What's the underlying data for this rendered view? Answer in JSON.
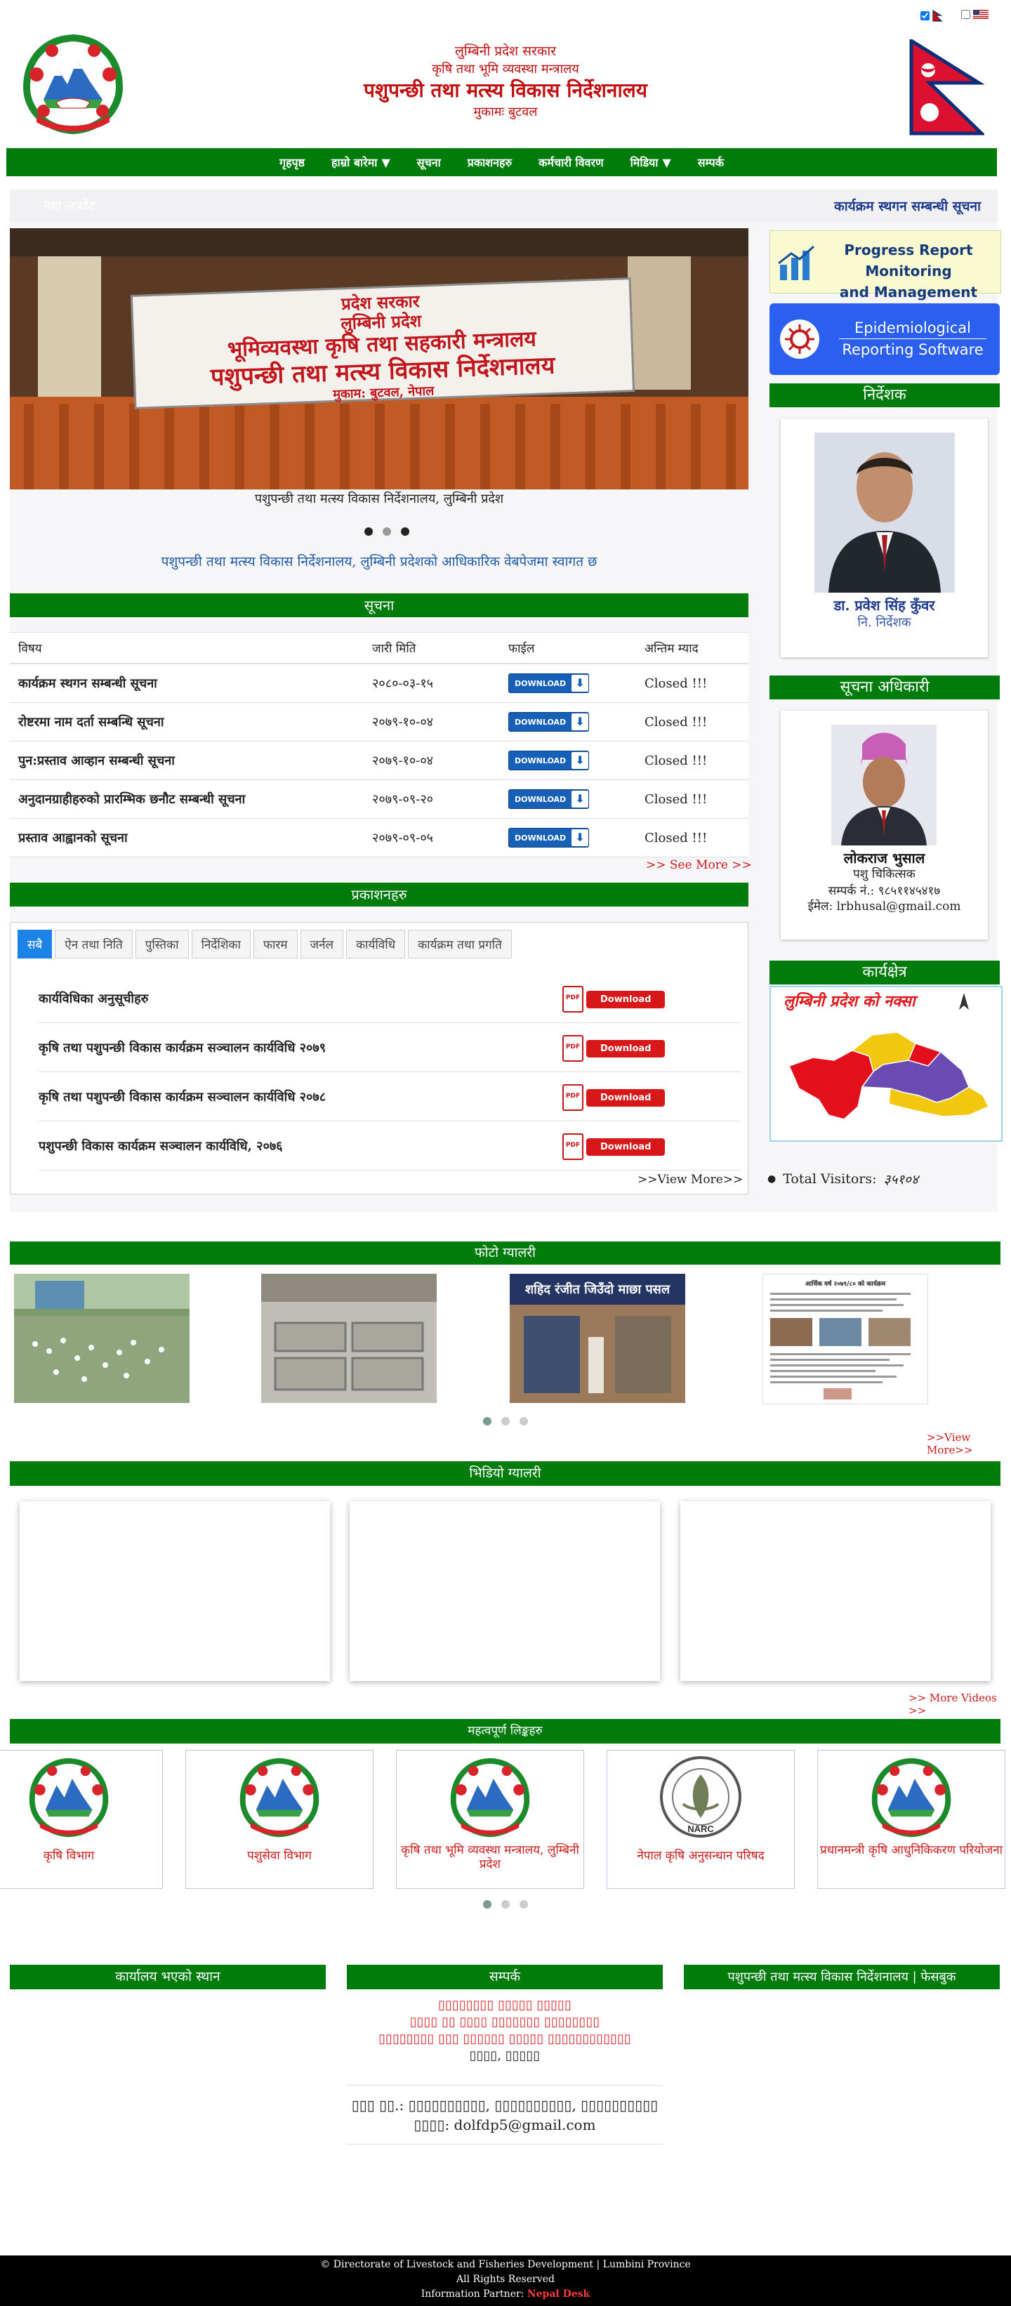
{
  "colors": {
    "green": "#007c0d",
    "red": "#c10d0d",
    "blue_link": "#1d3a8f",
    "download_blue": "#1660b7"
  },
  "header": {
    "line1": "लुम्बिनी प्रदेश सरकार",
    "line2": "कृषि तथा भूमि व्यवस्था मन्त्रालय",
    "line3": "पशुपन्छी तथा मत्स्य विकास निर्देशनालय",
    "line4": "मुकामः बुटवल",
    "emblem_icon": "nepal-emblem-icon",
    "flag_icon": "nepal-flag-icon"
  },
  "language": {
    "nepali_flag": "nepal-flag-icon",
    "english_flag": "us-flag-icon",
    "nepali_checked": true
  },
  "nav": {
    "items": [
      {
        "label": "गृहपृष्ठ"
      },
      {
        "label": "हाम्रो बारेमा",
        "dropdown": true
      },
      {
        "label": "सूचना"
      },
      {
        "label": "प्रकाशनहरु"
      },
      {
        "label": "कर्मचारी विवरण"
      },
      {
        "label": "मिडिया",
        "dropdown": true
      },
      {
        "label": "सम्पर्क"
      }
    ]
  },
  "ticker": {
    "left": "नया अपडेट",
    "right": "कार्यक्रम स्थगन सम्बन्धी सूचना"
  },
  "slider": {
    "sign_lines": [
      "प्रदेश सरकार",
      "लुम्बिनी प्रदेश",
      "भूमिव्यवस्था कृषि तथा सहकारी मन्त्रालय",
      "पशुपन्छी तथा मत्स्य विकास निर्देशनालय",
      "मुकाम: बुटवल, नेपाल"
    ],
    "caption": "पशुपन्छी तथा मत्स्य विकास निर्देशनालय, लुम्बिनी प्रदेश",
    "active_index": 2
  },
  "welcome": "पशुपन्छी तथा मत्स्य विकास निर्देशनालय, लुम्बिनी प्रदेशको आधिकारिक वेबपेजमा स्वागत छ",
  "notices": {
    "title": "सूचना",
    "headers": [
      "विषय",
      "जारी मिति",
      "फाईल",
      "अन्तिम म्याद"
    ],
    "download_label": "DOWNLOAD",
    "rows": [
      {
        "subject": "कार्यक्रम स्थगन सम्बन्धी सूचना",
        "date": "२०८०-०३-१५",
        "status": "Closed !!!"
      },
      {
        "subject": "रोष्टरमा नाम दर्ता सम्बन्धि सूचना",
        "date": "२०७९-१०-०४",
        "status": "Closed !!!"
      },
      {
        "subject": "पुन:प्रस्ताव आव्हान सम्बन्धी सूचना",
        "date": "२०७९-१०-०४",
        "status": "Closed !!!"
      },
      {
        "subject": "अनुदानग्राहीहरुको प्रारम्भिक छनौट सम्बन्धी सूचना",
        "date": "२०७९-०९-२०",
        "status": "Closed !!!"
      },
      {
        "subject": "प्रस्ताव आह्वानको सूचना",
        "date": "२०७९-०९-०५",
        "status": "Closed !!!"
      }
    ],
    "see_more": ">> See More >>"
  },
  "publications": {
    "title": "प्रकाशनहरु",
    "tabs": [
      "सबै",
      "ऐन तथा निति",
      "पुस्तिका",
      "निर्देशिका",
      "फारम",
      "जर्नल",
      "कार्यविधि",
      "कार्यक्रम तथा प्रगति"
    ],
    "items": [
      "कार्यविधिका अनुसूचीहरु",
      "कृषि तथा पशुपन्छी विकास कार्यक्रम सञ्चालन कार्यविधि २०७९",
      "कृषि तथा पशुपन्छी विकास कार्यक्रम सञ्चालन कार्यविधि २०७८",
      "पशुपन्छी विकास कार्यक्रम सञ्चालन कार्यविधि, २०७६"
    ],
    "download_label": "Download",
    "pdf_label": "PDF",
    "view_more": ">>View More>>"
  },
  "sidebar": {
    "progress_banner": {
      "line1": "Progress Report Monitoring",
      "line2": "and Management System"
    },
    "epi_banner": {
      "line1": "Epidemiological",
      "line2": "Reporting Software"
    },
    "director": {
      "title": "निर्देशक",
      "name": "डा. प्रवेश सिंह कुँवर",
      "role": "नि. निर्देशक"
    },
    "info_officer": {
      "title": "सूचना अधिकारी",
      "name": "लोकराज भुसाल",
      "role": "पशु चिकित्सक",
      "phone": "सम्पर्क नं.: ९८५११४५४१७",
      "email": "ईमेल: lrbhusal@gmail.com"
    },
    "work_area": {
      "title": "कार्यक्षेत्र",
      "map_title": "लुम्बिनी प्रदेश को नक्सा"
    },
    "visitors": {
      "label": "Total Visitors:",
      "value": "३५१०४"
    }
  },
  "photo_gallery": {
    "title": "फोटो ग्यालरी",
    "view_more": ">>View More>>",
    "shop_sign": "शहिद रंजीत जिउँदो माछा पसल",
    "doc_heading": "आर्थिक वर्ष २०७९/८० को कार्यक्रम"
  },
  "video_gallery": {
    "title": "भिडियो ग्यालरी",
    "more": ">> More Videos >>"
  },
  "links": {
    "title": "महत्वपूर्ण लिङ्कहरु",
    "items": [
      {
        "name": "कृषि विभाग"
      },
      {
        "name": "पशुसेवा विभाग"
      },
      {
        "name": "कृषि तथा भूमि व्यवस्था मन्त्रालय, लुम्बिनी प्रदेश"
      },
      {
        "name": "नेपाल कृषि अनुसन्धान परिषद",
        "logo": "NARC"
      },
      {
        "name": "प्रधानमन्त्री कृषि आधुनिकिकरण परियोजना"
      }
    ]
  },
  "footer_sections": {
    "location_title": "कार्यालय भएको स्थान",
    "contact_title": "सम्पर्क",
    "facebook_title": "पशुपन्छी तथा मत्स्य विकास निर्देशनालय | फेसबुक",
    "contact_lines": [
      "▯▯▯▯▯▯▯▯ ▯▯▯▯▯ ▯▯▯▯▯",
      "▯▯▯▯ ▯▯ ▯▯▯▯ ▯▯▯▯▯▯▯ ▯▯▯▯▯▯▯▯",
      "▯▯▯▯▯▯▯▯ ▯▯▯ ▯▯▯▯▯▯ ▯▯▯▯▯ ▯▯▯▯▯▯▯▯▯▯▯▯",
      "▯▯▯▯, ▯▯▯▯▯"
    ],
    "phone": "▯▯▯ ▯▯.: ▯▯▯▯▯▯▯▯▯▯, ▯▯▯▯▯▯▯▯▯▯, ▯▯▯▯▯▯▯▯▯▯",
    "email": "▯▯▯▯: dolfdp5@gmail.com"
  },
  "footer": {
    "copyright": "© Directorate of Livestock and Fisheries Development | Lumbini Province",
    "rights": "All Rights Reserved",
    "partner_label": "Information Partner:",
    "partner_name": "Nepal Desk"
  }
}
